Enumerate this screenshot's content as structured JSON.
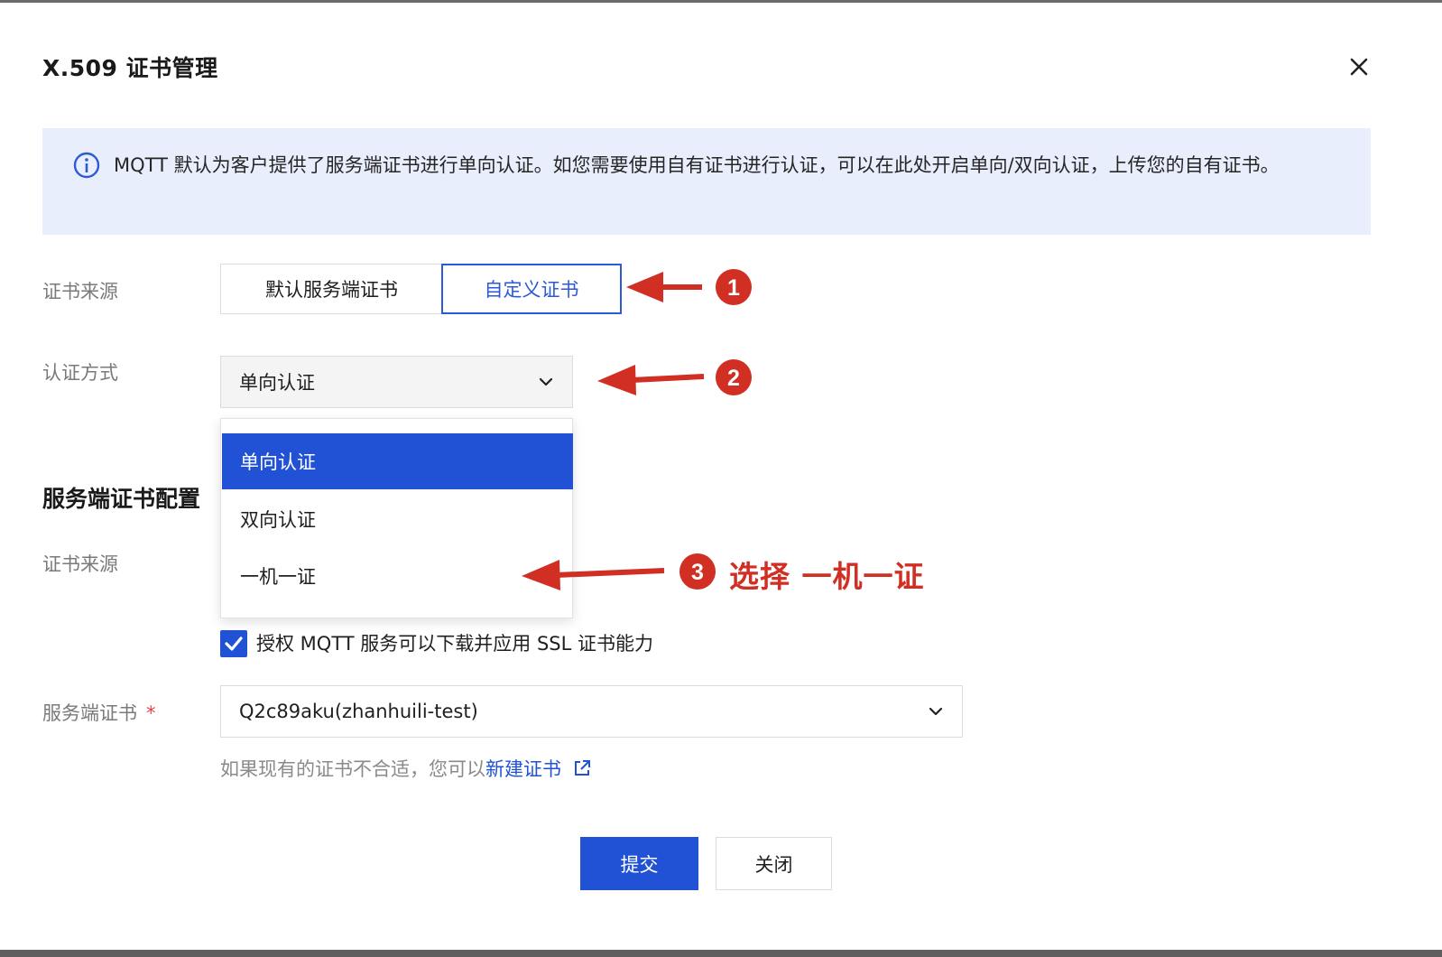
{
  "dialog": {
    "title": "X.509 证书管理",
    "close_icon": "close-icon"
  },
  "notice": {
    "icon": "info-icon",
    "text": "MQTT 默认为客户提供了服务端证书进行单向认证。如您需要使用自有证书进行认证，可以在此处开启单向/双向认证，上传您的自有证书。"
  },
  "form": {
    "cert_source_label": "证书来源",
    "cert_source_options": [
      "默认服务端证书",
      "自定义证书"
    ],
    "cert_source_selected": "自定义证书",
    "auth_method_label": "认证方式",
    "auth_method_value": "单向认证",
    "auth_method_options": [
      "单向认证",
      "双向认证",
      "一机一证"
    ]
  },
  "server_section": {
    "title": "服务端证书配置",
    "cert_source_label": "证书来源",
    "authorize_checkbox_label": "授权 MQTT 服务可以下载并应用 SSL 证书能力",
    "authorize_checked": true,
    "server_cert_label": "服务端证书",
    "required_mark": "*",
    "server_cert_value": "Q2c89aku(zhanhuili-test)",
    "hint_text": "如果现有的证书不合适，您可以",
    "hint_link": "新建证书"
  },
  "footer": {
    "submit_label": "提交",
    "close_label": "关闭"
  },
  "annotations": {
    "badge1": "1",
    "badge2": "2",
    "badge3": "3",
    "step3_text": "选择 一机一证"
  },
  "colors": {
    "primary": "#2152d6",
    "notice_bg": "#e8eefc",
    "annotation_red": "#d12e24",
    "required_red": "#e54545"
  }
}
